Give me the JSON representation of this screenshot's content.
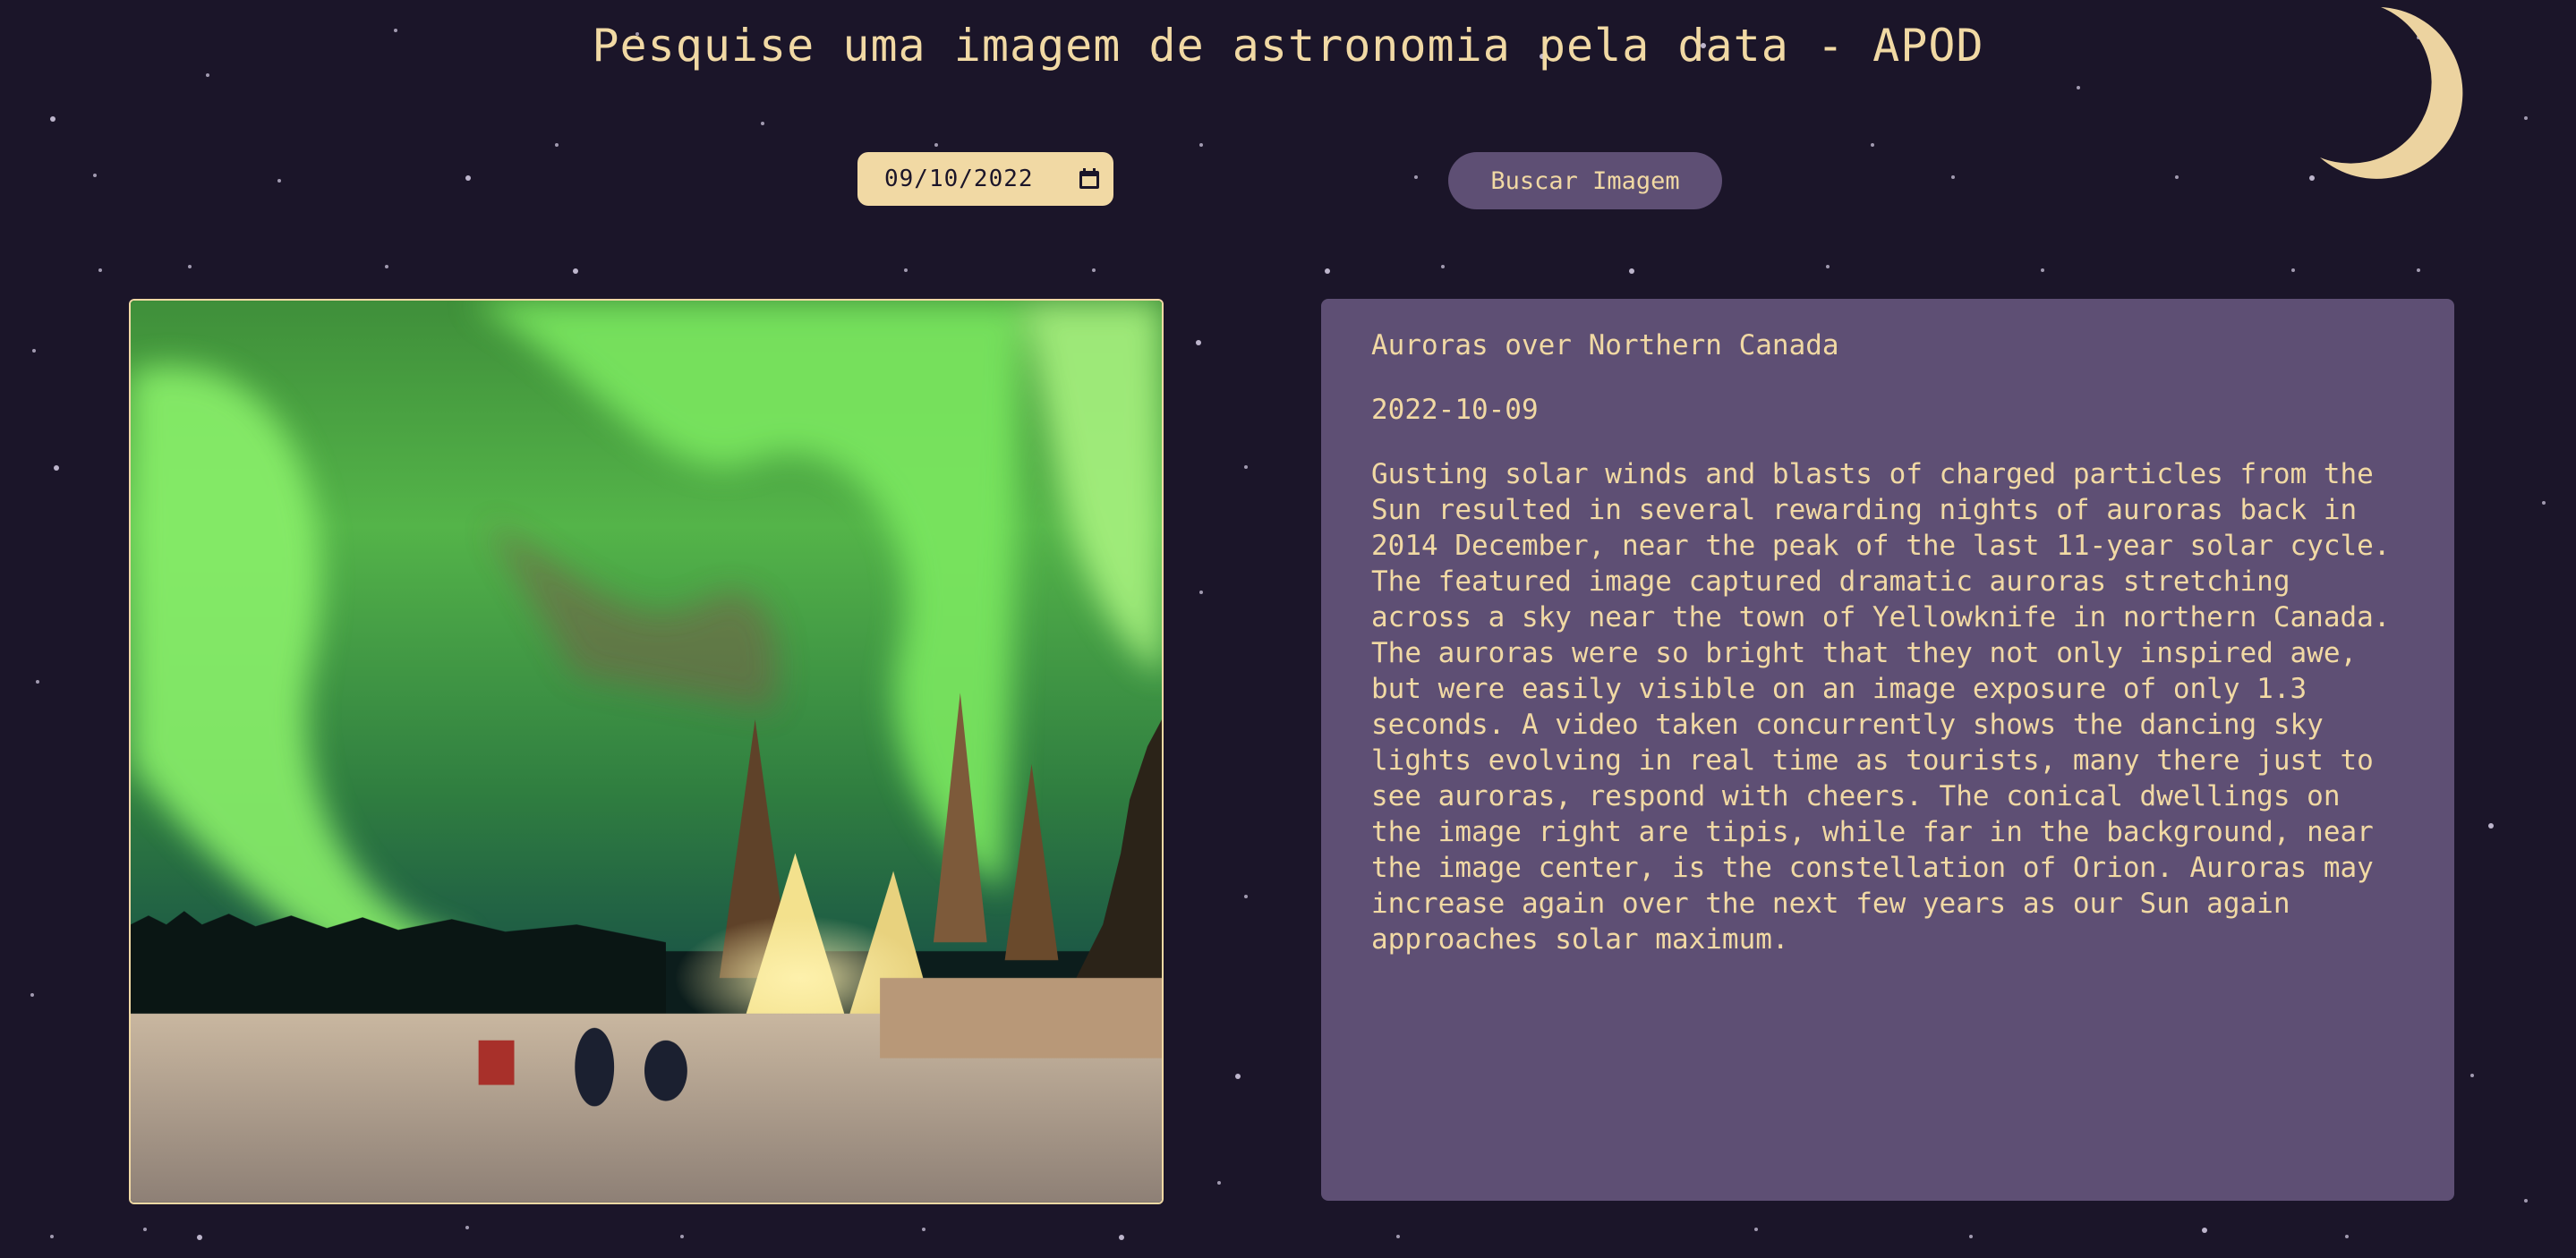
{
  "page": {
    "title": "Pesquise uma imagem de astronomia pela data - APOD"
  },
  "date_picker": {
    "value": "09/10/2022",
    "icon": "calendar-icon"
  },
  "search": {
    "button_label": "Buscar Imagem"
  },
  "apod": {
    "title": "Auroras over Northern Canada",
    "date": "2022-10-09",
    "explanation": "Gusting solar winds and blasts of charged particles from the Sun resulted in several rewarding nights of auroras back in 2014 December, near the peak of the last 11-year solar cycle. The featured image captured dramatic auroras stretching across a sky near the town of Yellowknife in northern Canada. The auroras were so bright that they not only inspired awe, but were easily visible on an image exposure of only 1.3 seconds. A video taken concurrently shows the dancing sky lights evolving in real time as tourists, many there just to see auroras, respond with cheers. The conical dwellings on the image right are tipis, while far in the background, near the image center, is the constellation of Orion. Auroras may increase again over the next few years as our Sun again approaches solar maximum.",
    "image_alt": "aurora photo"
  },
  "colors": {
    "background": "#1b1529",
    "accent": "#f1d9a4",
    "panel": "#5e4f74"
  },
  "decorations": {
    "moon_icon": "crescent-moon-icon"
  }
}
